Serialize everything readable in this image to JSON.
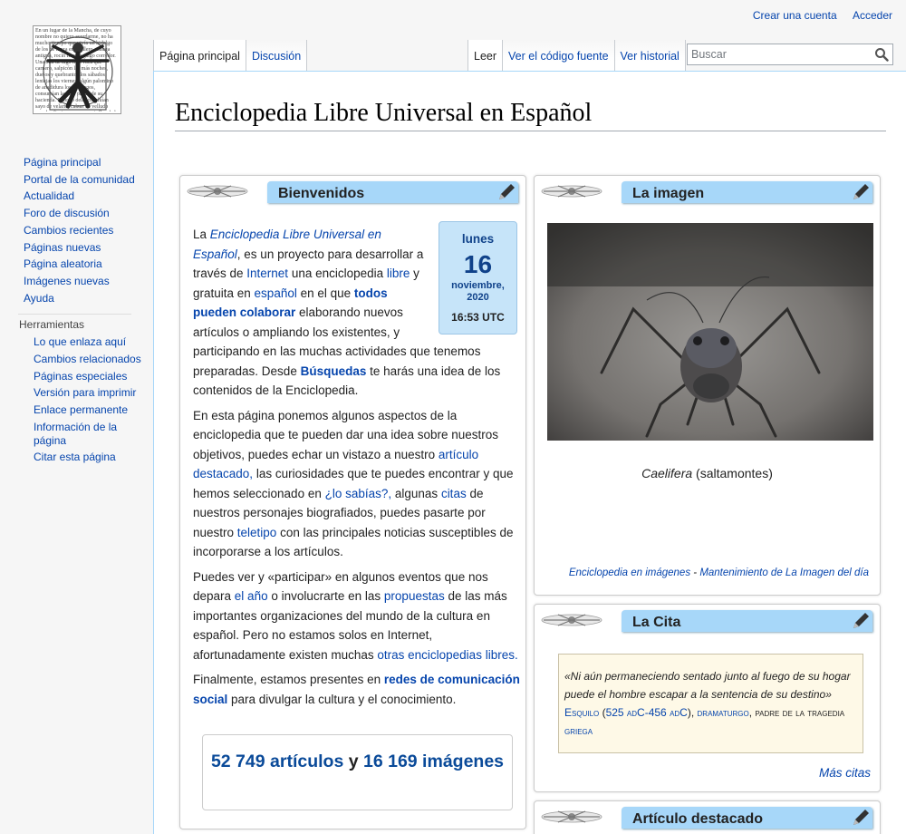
{
  "personal": {
    "create_account": "Crear una cuenta",
    "login": "Acceder"
  },
  "logo": {
    "text": "En un lugar de la Mancha, de cuyo nombre no quiero acordarme, no ha mucho tiempo que vivía un hidalgo de los de lanza en astillero, adarga antigua, rocín flaco y galgo corredor. Una olla de algo más vaca que carnero, salpicón las más noches, duelos y quebrantos los sábados, lentejas los viernes, algún palomino de añadidura los domingos, consumían las tres partes de su hacienda. El resto della concluían sayo de velarte, calzas de velludo para las fiestas con sus pantuflos de lo mismo, los días de entre semana se honraba con su vellori de lo más fino. Tenía en su casa una ama que pasaba de los cuarenta, y una sobrina que no llegaba a los veinte, y un mozo de campo y plaza, que así ensillaba el rocín como tomaba la podadera. Frisaba la edad de nuestro hidalgo con los cincuenta años, era de complexión recia, seco de carnes, enjuto de rostro; gran madrugador y amigo de la caza. Quieren decir que tenía el sobrenombre de Quijada o Quesada (que en esto hay alguna diferencia en los autores que deste caso escriben), aunque por conjeturas verosímiles se deja entender que se llama Quijana."
  },
  "tabs": {
    "left": [
      "Página principal",
      "Discusión"
    ],
    "right": [
      "Leer",
      "Ver el código fuente",
      "Ver historial"
    ]
  },
  "search": {
    "placeholder": "Buscar"
  },
  "sidebar": {
    "nav": [
      "Página principal",
      "Portal de la comunidad",
      "Actualidad",
      "Foro de discusión",
      "Cambios recientes",
      "Páginas nuevas",
      "Página aleatoria",
      "Imágenes nuevas",
      "Ayuda"
    ],
    "tools_heading": "Herramientas",
    "tools": [
      "Lo que enlaza aquí",
      "Cambios relacionados",
      "Páginas especiales",
      "Versión para imprimir",
      "Enlace permanente",
      "Información de la página",
      "Citar esta página"
    ]
  },
  "page": {
    "title": "Enciclopedia Libre Universal en Español"
  },
  "welcome": {
    "heading": "Bienvenidos",
    "date": {
      "weekday": "lunes",
      "day": "16",
      "month_year": "noviembre, 2020",
      "time": "16:53 UTC"
    },
    "p1": {
      "t1": "La ",
      "l1": "Enciclopedia Libre Universal en Español",
      "t2": ", es un proyecto para desarrollar a través de ",
      "l2": "Internet",
      "t3": " una enciclopedia ",
      "l3": "libre",
      "t4": " y gratuita en ",
      "l4": "español",
      "t5": " en el que ",
      "l5": "todos pueden colaborar",
      "t6": " elaborando nuevos artículos o ampliando los existentes, y participando en las muchas actividades que tenemos preparadas. Desde ",
      "l6": "Búsquedas",
      "t7": " te harás una idea de los contenidos de la Enciclopedia."
    },
    "p2": {
      "t1": "En esta página ponemos algunos aspectos de la enciclopedia que te pueden dar una idea sobre nuestros objetivos, puedes echar un vistazo a nuestro ",
      "l1": "artículo destacado,",
      "t2": " las curiosidades que te puedes encontrar y que hemos seleccionado en ",
      "l2": "¿lo sabías?,",
      "t3": " algunas ",
      "l3": "citas",
      "t4": " de nuestros personajes biografiados, puedes pasarte por nuestro ",
      "l4": "teletipo",
      "t5": " con las principales noticias susceptibles de incorporarse a los artículos."
    },
    "p3": {
      "t1": "Puedes ver y «participar» en algunos eventos que nos depara ",
      "l1": "el año",
      "t2": " o involucrarte en las ",
      "l2": "propuestas",
      "t3": " de las más importantes organizaciones del mundo de la cultura en español. Pero no estamos solos en Internet, afortunadamente existen muchas ",
      "l3": "otras enciclopedias libres."
    },
    "p4": {
      "t1": "Finalmente, estamos presentes en ",
      "l1": "redes de comunicación social",
      "t2": " para divulgar la cultura y el conocimiento."
    },
    "stats": {
      "articles": "52 749 artículos",
      "and": "y",
      "images": "16 169 imágenes"
    }
  },
  "image": {
    "heading": "La imagen",
    "caption_italic": "Caelifera",
    "caption_rest": " (saltamontes)",
    "link1": "Enciclopedia en imágenes",
    "sep": " - ",
    "link2": "Mantenimiento de La Imagen del día"
  },
  "quote": {
    "heading": "La Cita",
    "text": "«Ni aún permaneciendo sentado junto al fuego de su hogar puede el hombre escapar a la sentencia de su destino»",
    "author": "Esquilo",
    "open_paren": " (",
    "years": "525 adC-456 adC",
    "close_paren": "), ",
    "role": "dramaturgo",
    "rest": ", padre de la tragedia ",
    "nation": "griega",
    "more": "Más citas"
  },
  "featured": {
    "heading": "Artículo destacado"
  },
  "colors": {
    "link": "#0645ad",
    "header_bar": "#a7d7f9",
    "date_box": "#c6e4f9",
    "quote_bg": "#fef9e7"
  }
}
